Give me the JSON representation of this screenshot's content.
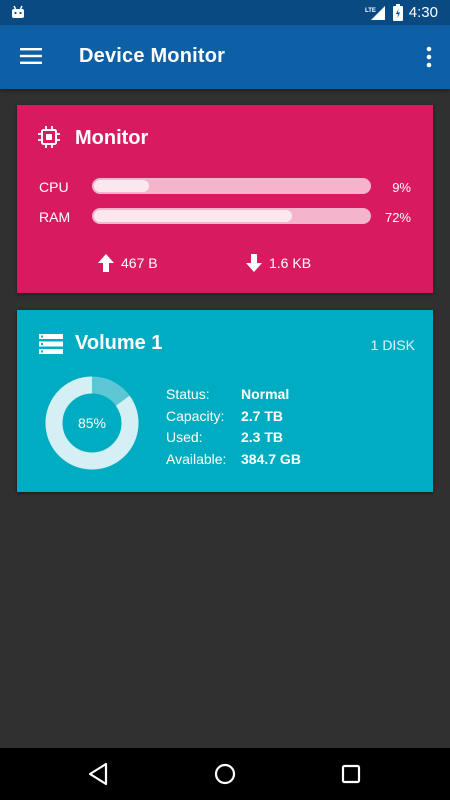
{
  "status_bar": {
    "network": "LTE",
    "time": "4:30"
  },
  "app_bar": {
    "title": "Device Monitor"
  },
  "monitor_card": {
    "title": "Monitor",
    "color": "#d81b60",
    "cpu": {
      "label": "CPU",
      "percent_text": "9%",
      "fraction": 0.09
    },
    "ram": {
      "label": "RAM",
      "percent_text": "72%",
      "fraction": 0.72
    },
    "upload": "467 B",
    "download": "1.6 KB"
  },
  "volume_card": {
    "title": "Volume 1",
    "disk_count": "1 DISK",
    "color": "#00acc1",
    "usage_text": "85%",
    "usage_fraction": 0.85,
    "stats": [
      {
        "key": "Status:",
        "value": "Normal"
      },
      {
        "key": "Capacity:",
        "value": "2.7 TB"
      },
      {
        "key": "Used:",
        "value": "2.3 TB"
      },
      {
        "key": "Available:",
        "value": "384.7 GB"
      }
    ]
  },
  "icons": [
    "android-icon",
    "lte-signal-icon",
    "battery-icon",
    "menu-icon",
    "more-vert-icon",
    "chip-icon",
    "arrow-up-icon",
    "arrow-down-icon",
    "storage-icon",
    "back-icon",
    "home-icon",
    "recents-icon"
  ]
}
